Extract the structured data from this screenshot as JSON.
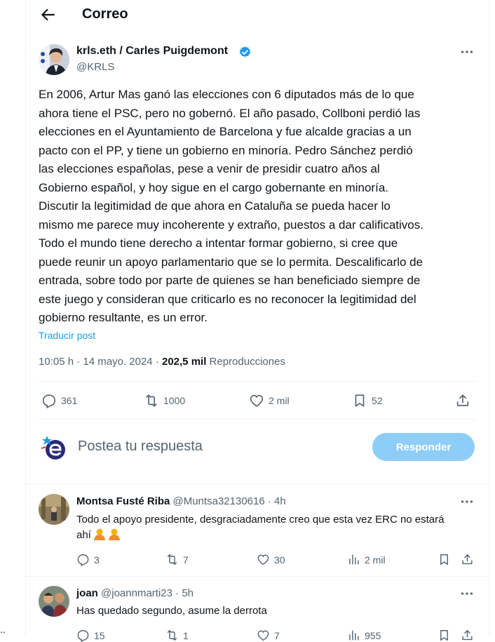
{
  "header": {
    "title": "Correo"
  },
  "post": {
    "author_name": "krls.eth / Carles Puigdemont",
    "author_handle": "@KRLS",
    "text": "En 2006, Artur Mas ganó las elecciones con 6 diputados más de lo que\nahora tiene el PSC, pero no gobernó. El año pasado, Collboni perdió las\nelecciones en el Ayuntamiento de Barcelona y fue alcalde gracias a un\npacto con el PP, y tiene un gobierno en minoría. Pedro Sánchez perdió\nlas elecciones españolas, pese a venir de presidir cuatro años al\nGobierno español, y hoy sigue en el cargo gobernante en minoría.\nDiscutir la legitimidad de que ahora en Cataluña se pueda hacer lo\nmismo me parece muy incoherente y extraño, puestos a dar calificativos.\nTodo el mundo tiene derecho a intentar formar gobierno, si cree que\npuede reunir un apoyo parlamentario que se lo permita. Descalificarlo de\nentrada, sobre todo por parte de quienes se han beneficiado siempre de\neste juego y consideran que criticarlo es no reconocer la legitimidad del\ngobierno resultante, es un error.",
    "translate_label": "Traducir post",
    "time": "10:05 h",
    "sep1": "·",
    "date": "14 mayo. 2024",
    "sep2": "·",
    "views_count": "202,5 mil",
    "views_label": "Reproducciones",
    "stats": {
      "replies": "361",
      "reposts": "1000",
      "likes": "2 mil",
      "bookmarks": "52"
    }
  },
  "reply_box": {
    "placeholder": "Postea tu respuesta",
    "button_label": "Responder"
  },
  "comments": [
    {
      "name": "Montsa Fusté Riba",
      "handle": "@Muntsa32130616",
      "sep": "·",
      "time": "4h",
      "text": "Todo el apoyo presidente, desgraciadamente creo que esta vez ERC no estará ahí",
      "stats": {
        "replies": "3",
        "reposts": "7",
        "likes": "30",
        "views": "2 mil"
      }
    },
    {
      "name": "joan",
      "handle": "@joannmarti23",
      "sep": "·",
      "time": "5h",
      "text": "Has quedado segundo, asume la derrota",
      "stats": {
        "replies": "15",
        "reposts": "1",
        "likes": "7",
        "views": "955"
      }
    }
  ],
  "left_edge_text": "..",
  "colors": {
    "accent": "#1d9bf0",
    "reply_button": "#8ecdf8",
    "muted": "#536471",
    "text": "#0f1419",
    "divider": "#eff3f4"
  },
  "icons": [
    "back-arrow-icon",
    "verified-badge-icon",
    "more-options-icon",
    "reply-icon",
    "repost-icon",
    "like-icon",
    "bookmark-icon",
    "share-icon",
    "views-icon"
  ]
}
